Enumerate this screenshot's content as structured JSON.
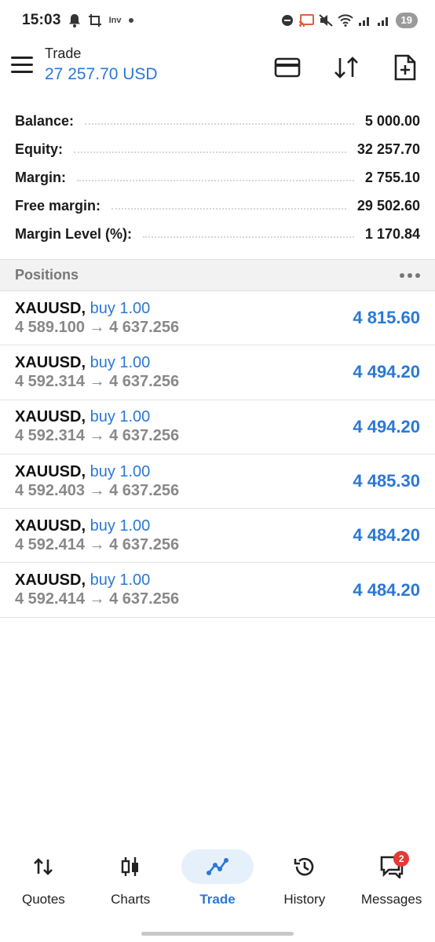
{
  "status_bar": {
    "time": "15:03",
    "indicator_text": "Inv",
    "battery": "19"
  },
  "header": {
    "title": "Trade",
    "balance": "27 257.70 USD"
  },
  "account": [
    {
      "label": "Balance:",
      "value": "5 000.00"
    },
    {
      "label": "Equity:",
      "value": "32 257.70"
    },
    {
      "label": "Margin:",
      "value": "2 755.10"
    },
    {
      "label": "Free margin:",
      "value": "29 502.60"
    },
    {
      "label": "Margin Level (%):",
      "value": "1 170.84"
    }
  ],
  "positions_header": {
    "title": "Positions"
  },
  "positions": [
    {
      "symbol": "XAUUSD,",
      "side": "buy 1.00",
      "prices": "4 589.100 → 4 637.256",
      "profit": "4 815.60"
    },
    {
      "symbol": "XAUUSD,",
      "side": "buy 1.00",
      "prices": "4 592.314 → 4 637.256",
      "profit": "4 494.20"
    },
    {
      "symbol": "XAUUSD,",
      "side": "buy 1.00",
      "prices": "4 592.314 → 4 637.256",
      "profit": "4 494.20"
    },
    {
      "symbol": "XAUUSD,",
      "side": "buy 1.00",
      "prices": "4 592.403 → 4 637.256",
      "profit": "4 485.30"
    },
    {
      "symbol": "XAUUSD,",
      "side": "buy 1.00",
      "prices": "4 592.414 → 4 637.256",
      "profit": "4 484.20"
    },
    {
      "symbol": "XAUUSD,",
      "side": "buy 1.00",
      "prices": "4 592.414 → 4 637.256",
      "profit": "4 484.20"
    }
  ],
  "nav": {
    "quotes": "Quotes",
    "charts": "Charts",
    "trade": "Trade",
    "history": "History",
    "messages": "Messages",
    "messages_badge": "2"
  },
  "colors": {
    "accent": "#2b78d4",
    "badge": "#e53935"
  }
}
